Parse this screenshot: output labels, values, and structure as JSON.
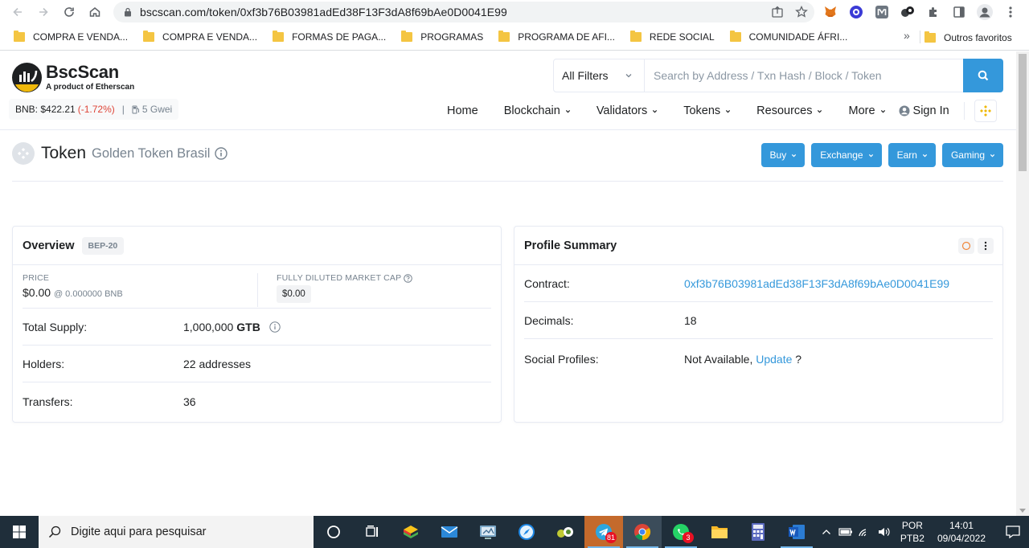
{
  "browser": {
    "url": "bscscan.com/token/0xf3b76B03981adEd38F13F3dA8f69bAe0D0041E99",
    "bookmarks": [
      "COMPRA E VENDA...",
      "COMPRA E VENDA...",
      "FORMAS DE PAGA...",
      "PROGRAMAS",
      "PROGRAMA DE AFI...",
      "REDE SOCIAL",
      "COMUNIDADE ÁFRI..."
    ],
    "overflow": "»",
    "other_bookmarks": "Outros favoritos"
  },
  "site": {
    "logo_title": "BscScan",
    "logo_sub": "A product of Etherscan",
    "bnb_price_label": "BNB: $422.21",
    "bnb_change": "(-1.72%)",
    "separator": "|",
    "gas": "5 Gwei",
    "filter_label": "All Filters",
    "search_placeholder": "Search by Address / Txn Hash / Block / Token",
    "nav": {
      "home": "Home",
      "blockchain": "Blockchain",
      "validators": "Validators",
      "tokens": "Tokens",
      "resources": "Resources",
      "more": "More",
      "sign_in": "Sign In"
    }
  },
  "token": {
    "label": "Token",
    "name": "Golden Token Brasil",
    "buttons": {
      "buy": "Buy",
      "exchange": "Exchange",
      "earn": "Earn",
      "gaming": "Gaming"
    }
  },
  "overview": {
    "title": "Overview",
    "badge": "BEP-20",
    "price_label": "PRICE",
    "price_value": "$0.00",
    "price_bnb": "@ 0.000000 BNB",
    "mcap_label": "FULLY DILUTED MARKET CAP",
    "mcap_value": "$0.00",
    "total_supply_label": "Total Supply:",
    "total_supply_value": "1,000,000",
    "total_supply_symbol": "GTB",
    "holders_label": "Holders:",
    "holders_value": "22 addresses",
    "transfers_label": "Transfers:",
    "transfers_value": "36"
  },
  "profile": {
    "title": "Profile Summary",
    "contract_label": "Contract:",
    "contract_value": "0xf3b76B03981adEd38F13F3dA8f69bAe0D0041E99",
    "decimals_label": "Decimals:",
    "decimals_value": "18",
    "social_label": "Social Profiles:",
    "social_na": "Not Available,",
    "social_update": "Update",
    "social_q": "?"
  },
  "taskbar": {
    "search_placeholder": "Digite aqui para pesquisar",
    "telegram_badge": "81",
    "whatsapp_badge": "3",
    "lang_top": "POR",
    "lang_bottom": "PTB2",
    "time": "14:01",
    "date": "09/04/2022"
  },
  "colors": {
    "accent": "#3498db",
    "negative": "#de4437",
    "bnb_yellow": "#f0b90b",
    "taskbar": "#1f2e3a"
  }
}
